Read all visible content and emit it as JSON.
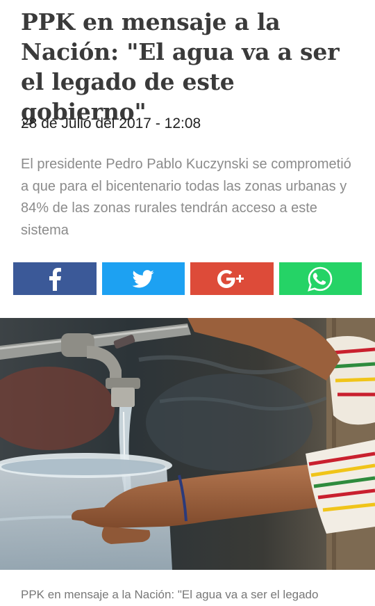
{
  "article": {
    "headline": "PPK en mensaje a la Nación: \"El agua va a ser el legado de este gobierno\"",
    "date": "28 de Julio del 2017 - 12:08",
    "summary": "El presidente Pedro Pablo Kuczynski se comprometió a que para el bicentenario todas las zonas urbanas y 84% de las zonas rurales tendrán acceso a este sistema",
    "caption": "PPK en mensaje a la Nación: \"El agua va a ser el legado"
  },
  "share": [
    {
      "network": "facebook",
      "icon": "facebook-icon",
      "color": "#3b5998"
    },
    {
      "network": "twitter",
      "icon": "twitter-icon",
      "color": "#1da1f2"
    },
    {
      "network": "google-plus",
      "icon": "google-plus-icon",
      "color": "#dd4b39"
    },
    {
      "network": "whatsapp",
      "icon": "whatsapp-icon",
      "color": "#25d366"
    }
  ],
  "photo": {
    "subject": "water-tap-filling-bucket-photo"
  }
}
